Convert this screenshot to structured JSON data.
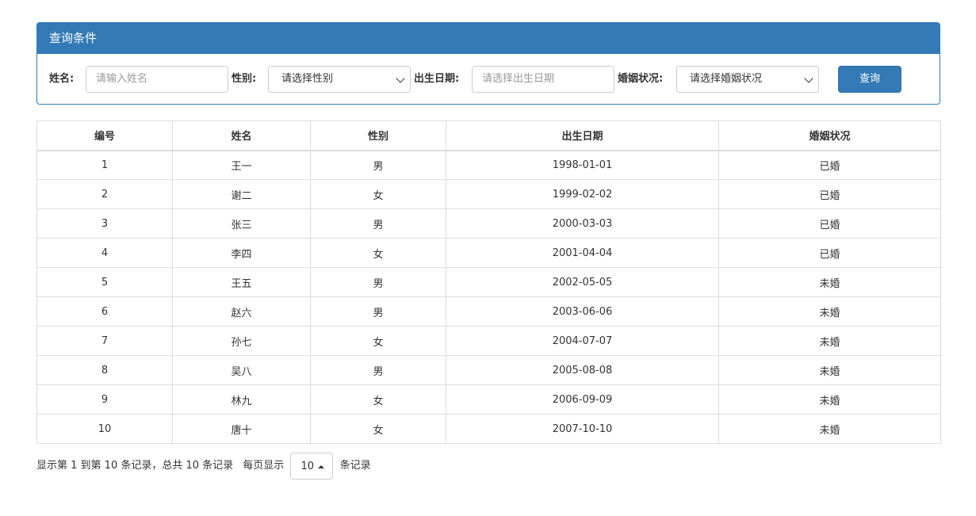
{
  "panel": {
    "title": "查询条件"
  },
  "filters": {
    "name_label": "姓名:",
    "name_placeholder": "请输入姓名",
    "gender_label": "性别:",
    "gender_value": "请选择性别",
    "birth_label": "出生日期:",
    "birth_placeholder": "请选择出生日期",
    "marital_label": "婚姻状况:",
    "marital_value": "请选择婚姻状况",
    "query_button": "查询"
  },
  "table": {
    "headers": [
      "编号",
      "姓名",
      "性别",
      "出生日期",
      "婚姻状况"
    ],
    "rows": [
      [
        "1",
        "王一",
        "男",
        "1998-01-01",
        "已婚"
      ],
      [
        "2",
        "谢二",
        "女",
        "1999-02-02",
        "已婚"
      ],
      [
        "3",
        "张三",
        "男",
        "2000-03-03",
        "已婚"
      ],
      [
        "4",
        "李四",
        "女",
        "2001-04-04",
        "已婚"
      ],
      [
        "5",
        "王五",
        "男",
        "2002-05-05",
        "未婚"
      ],
      [
        "6",
        "赵六",
        "男",
        "2003-06-06",
        "未婚"
      ],
      [
        "7",
        "孙七",
        "女",
        "2004-07-07",
        "未婚"
      ],
      [
        "8",
        "吴八",
        "男",
        "2005-08-08",
        "未婚"
      ],
      [
        "9",
        "林九",
        "女",
        "2006-09-09",
        "未婚"
      ],
      [
        "10",
        "唐十",
        "女",
        "2007-10-10",
        "未婚"
      ]
    ]
  },
  "pagination": {
    "summary": "显示第 1 到第 10 条记录，总共 10 条记录",
    "per_page_prefix": "每页显示",
    "page_size": "10",
    "per_page_suffix": "条记录"
  },
  "colors": {
    "primary": "#337ab7",
    "border": "#dddddd"
  },
  "icons": {
    "select_arrow": "chevron-down-icon",
    "page_size_caret": "caret-up-icon"
  }
}
